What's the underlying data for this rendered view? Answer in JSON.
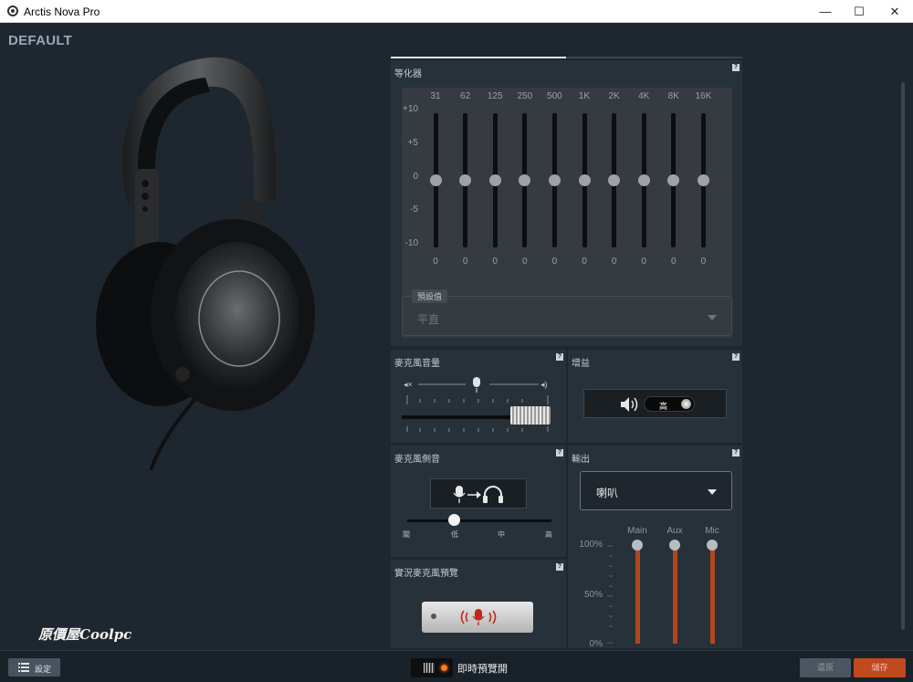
{
  "window": {
    "title": "Arctis Nova Pro",
    "minimize_glyph": "—",
    "maximize_glyph": "☐",
    "close_glyph": "✕"
  },
  "preset_name": "DEFAULT",
  "watermark": "原價屋Coolpc",
  "equalizer": {
    "title": "等化器",
    "help": "?",
    "frequencies": [
      "31",
      "62",
      "125",
      "250",
      "500",
      "1K",
      "2K",
      "4K",
      "8K",
      "16K"
    ],
    "values": [
      "0",
      "0",
      "0",
      "0",
      "0",
      "0",
      "0",
      "0",
      "0",
      "0"
    ],
    "db_labels": [
      "+10",
      "+5",
      "0",
      "-5",
      "-10"
    ],
    "preset_legend": "預設值",
    "preset_value": "平直"
  },
  "mic_volume": {
    "title": "麥克風音量",
    "help": "?",
    "level": 0.88
  },
  "gain": {
    "title": "增益",
    "help": "?",
    "value": "高"
  },
  "sidetone": {
    "title": "麥克風側音",
    "help": "?",
    "labels": [
      "關",
      "低",
      "中",
      "高"
    ],
    "selected": "低"
  },
  "output": {
    "title": "輸出",
    "help": "?",
    "device": "喇叭",
    "channels": [
      "Main",
      "Aux",
      "Mic"
    ],
    "percent_labels": [
      "100%",
      "50%",
      "0%"
    ],
    "levels": [
      1.0,
      1.0,
      1.0
    ]
  },
  "live_preview": {
    "title": "實況麥克風預覽",
    "help": "?"
  },
  "bottom": {
    "settings_label": "設定",
    "preview_label": "即時預覽開",
    "revert_label": "還原",
    "save_label": "儲存"
  },
  "colors": {
    "accent": "#c0491e",
    "mix_fill": "#b4461e",
    "background": "#1e2730"
  }
}
